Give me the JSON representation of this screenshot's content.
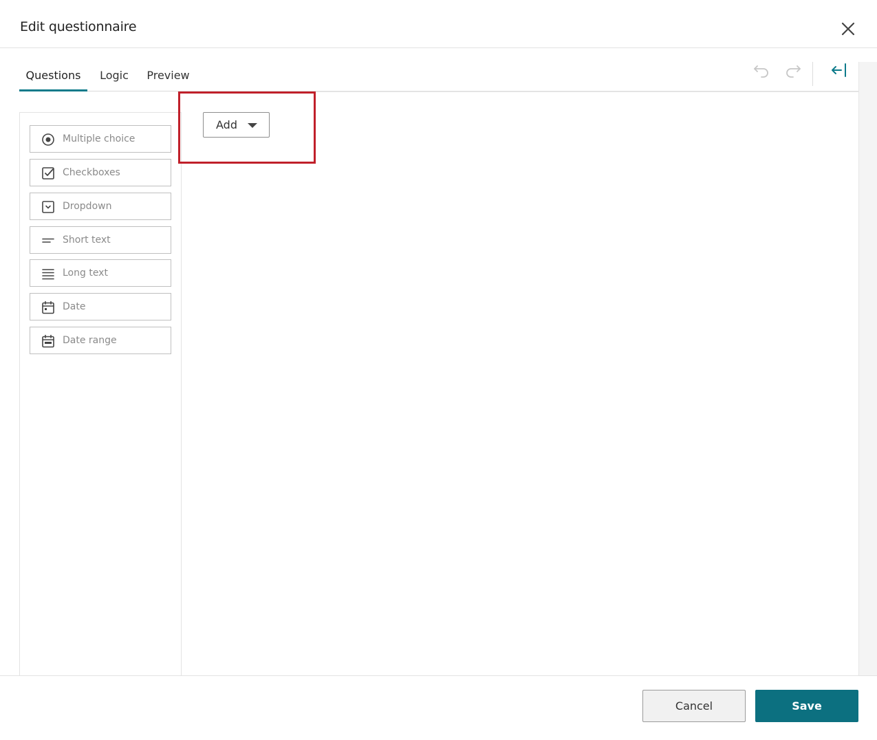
{
  "dialog": {
    "title": "Edit questionnaire"
  },
  "tabs": [
    {
      "label": "Questions",
      "active": true
    },
    {
      "label": "Logic",
      "active": false
    },
    {
      "label": "Preview",
      "active": false
    }
  ],
  "toolbar": {
    "undo_icon": "undo-icon",
    "redo_icon": "redo-icon",
    "collapse_icon": "collapse-panel-icon"
  },
  "palette": {
    "items": [
      {
        "label": "Multiple choice",
        "icon": "radio-icon"
      },
      {
        "label": "Checkboxes",
        "icon": "checkbox-icon"
      },
      {
        "label": "Dropdown",
        "icon": "dropdown-icon"
      },
      {
        "label": "Short text",
        "icon": "short-text-icon"
      },
      {
        "label": "Long text",
        "icon": "long-text-icon"
      },
      {
        "label": "Date",
        "icon": "calendar-icon"
      },
      {
        "label": "Date range",
        "icon": "calendar-range-icon"
      }
    ]
  },
  "main": {
    "add_label": "Add"
  },
  "footer": {
    "cancel_label": "Cancel",
    "save_label": "Save"
  },
  "colors": {
    "accent": "#0c7a8a",
    "highlight": "#c0202a",
    "save_bg": "#0c7080"
  }
}
